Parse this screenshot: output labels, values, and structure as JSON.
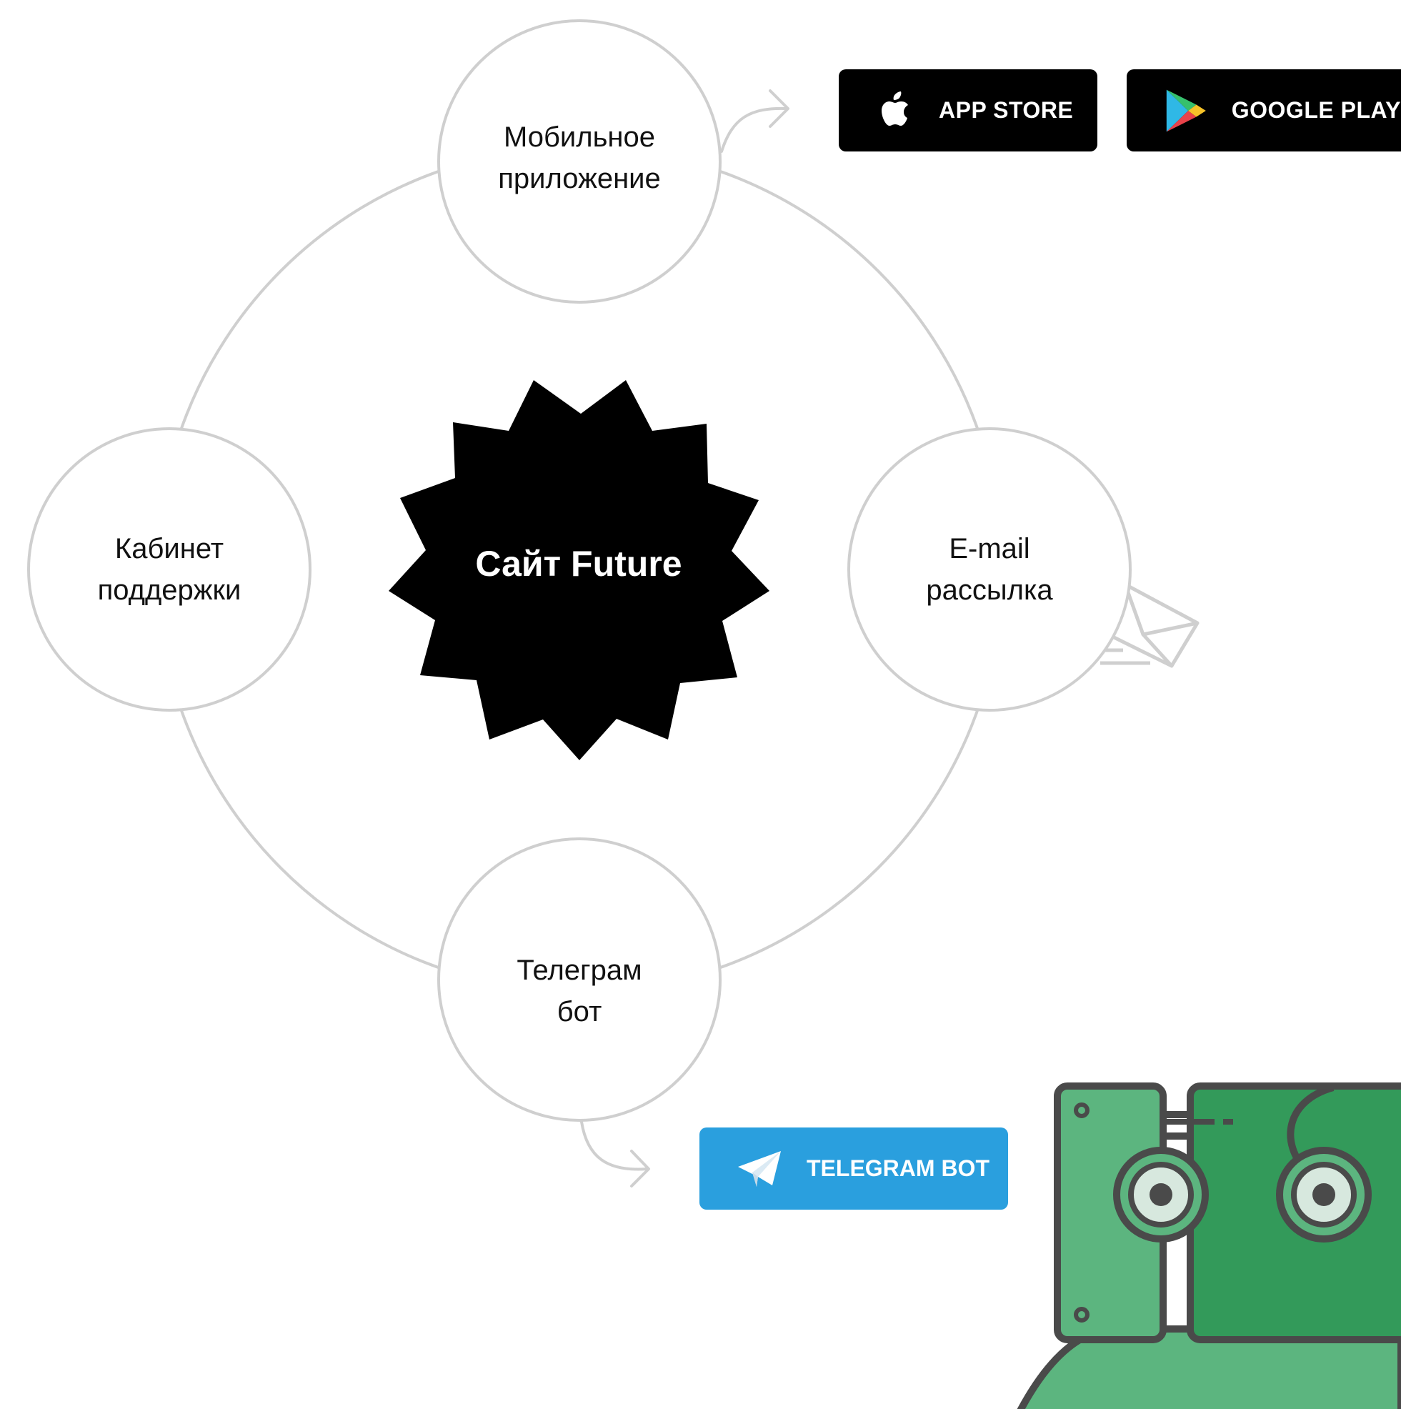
{
  "center": {
    "title": "Сайт Future"
  },
  "nodes": {
    "mobile": {
      "line1": "Мобильное",
      "line2": "приложение"
    },
    "email": {
      "line1": "E-mail",
      "line2": "рассылка"
    },
    "support": {
      "line1": "Кабинет",
      "line2": "поддержки"
    },
    "telegram": {
      "line1": "Телеграм",
      "line2": "бот"
    }
  },
  "buttons": {
    "app_store": {
      "label": "APP STORE",
      "icon": "apple-icon",
      "color": "#000000"
    },
    "google_play": {
      "label": "GOOGLE PLAY",
      "icon": "google-play-icon",
      "color": "#000000"
    },
    "telegram_bot": {
      "label": "TELEGRAM BOT",
      "icon": "telegram-icon",
      "color": "#2a9fde"
    }
  },
  "colors": {
    "outline": "#cfcfcf",
    "robot_green": "#5cb57f",
    "robot_dark_green": "#339a5a",
    "robot_stroke": "#4a4a4a"
  }
}
